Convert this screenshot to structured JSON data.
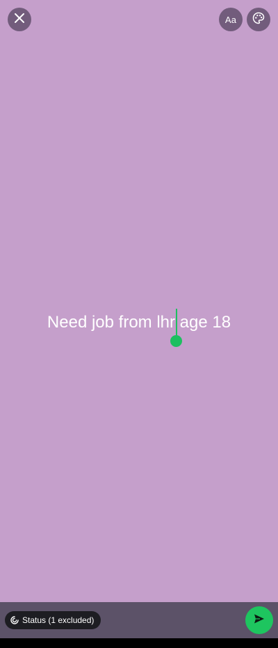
{
  "toolbar": {
    "close_icon": "close-icon",
    "font_label": "Aa",
    "palette_icon": "palette-icon"
  },
  "composer": {
    "text": "Need job from lhr age 18",
    "background_color": "#c59fcb",
    "cursor_color": "#1dbf60"
  },
  "bottom_bar": {
    "audience_icon": "status-audience-icon",
    "audience_label": "Status (1 excluded)",
    "send_icon": "send-icon",
    "send_color": "#1ec55f"
  }
}
